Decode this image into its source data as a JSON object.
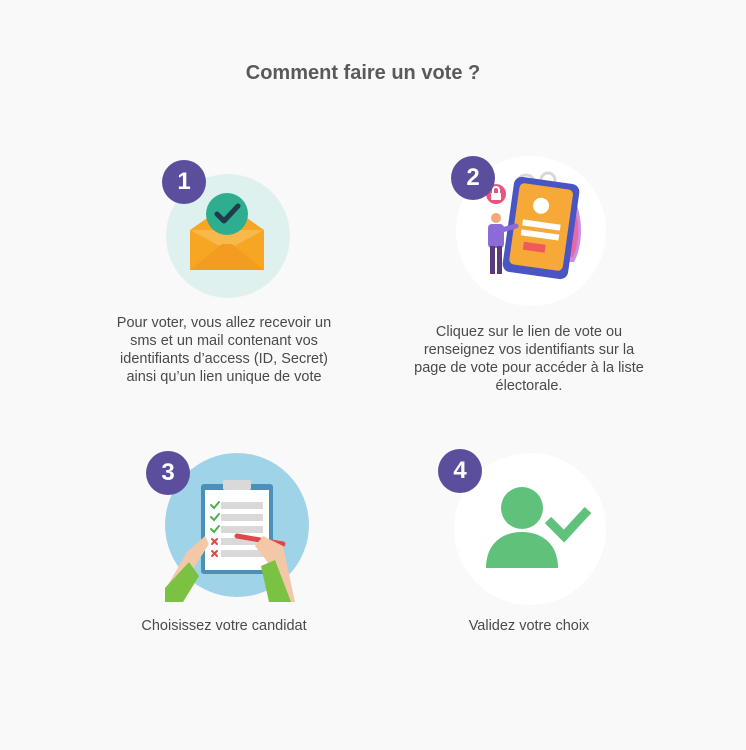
{
  "title": "Comment faire un vote ?",
  "steps": [
    {
      "number": "1",
      "icon": "envelope-check-icon",
      "text": "Pour voter, vous allez recevoir un sms et un mail contenant vos identifiants d’access (ID, Secret) ainsi qu’un lien unique de vote"
    },
    {
      "number": "2",
      "icon": "phone-login-icon",
      "text": "Cliquez sur le lien de vote ou renseignez vos identifiants sur la page de vote pour accéder à la liste électorale."
    },
    {
      "number": "3",
      "icon": "clipboard-checklist-icon",
      "text": "Choisissez votre candidat"
    },
    {
      "number": "4",
      "icon": "user-check-icon",
      "text": "Validez votre choix"
    }
  ],
  "colors": {
    "badge": "#5b4f9d",
    "step1_bg": "#dff1ee",
    "step3_bg": "#9fd3e8",
    "green": "#5fc17a"
  }
}
